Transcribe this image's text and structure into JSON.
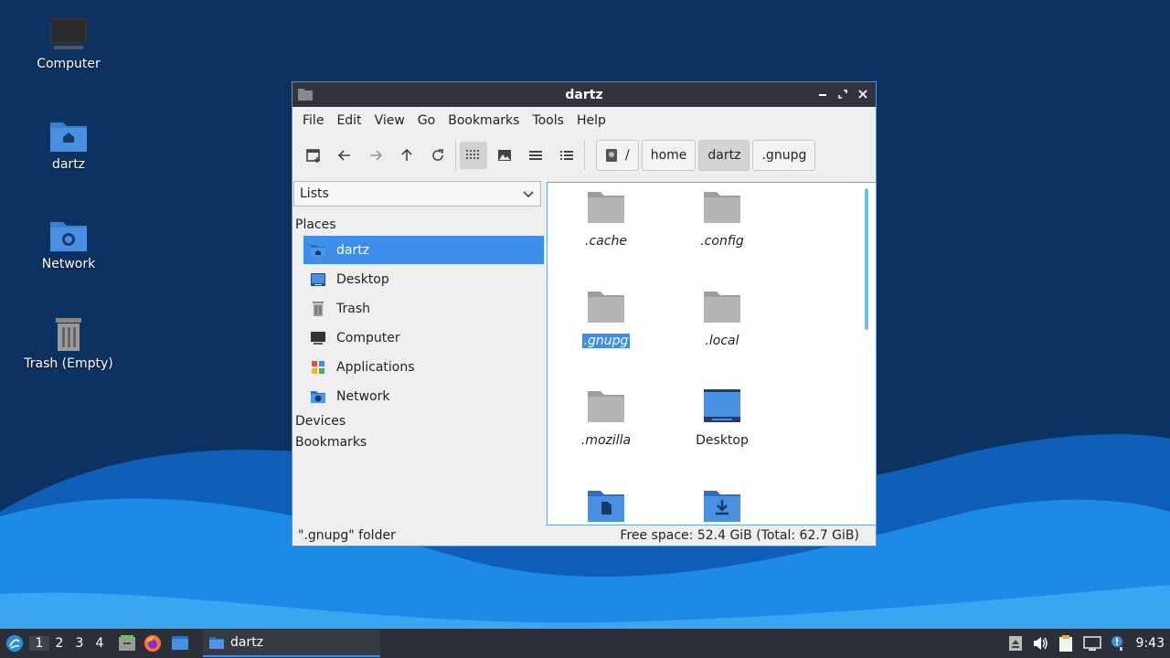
{
  "desktop": {
    "icons": [
      {
        "label": "Computer",
        "icon": "computer-icon"
      },
      {
        "label": "dartz",
        "icon": "home-folder-icon"
      },
      {
        "label": "Network",
        "icon": "network-folder-icon"
      },
      {
        "label": "Trash (Empty)",
        "icon": "trash-icon"
      }
    ]
  },
  "window": {
    "title": "dartz",
    "controls": {
      "minimize": "minimize-icon",
      "maximize": "maximize-icon",
      "close": "close-icon"
    },
    "menu": [
      "File",
      "Edit",
      "View",
      "Go",
      "Bookmarks",
      "Tools",
      "Help"
    ],
    "toolbar": {
      "buttons": [
        "new-tab-icon",
        "back-icon",
        "forward-icon",
        "up-icon",
        "reload-icon",
        "icon-view-icon",
        "thumbnail-view-icon",
        "compact-view-icon",
        "detailed-list-icon"
      ],
      "active_view": "icon-view-icon"
    },
    "breadcrumbs": [
      {
        "label": "/",
        "icon": "root-drive-icon"
      },
      {
        "label": "home"
      },
      {
        "label": "dartz",
        "current": true
      },
      {
        "label": ".gnupg"
      }
    ],
    "side_pane": {
      "mode": "Lists",
      "places_heading": "Places",
      "places": [
        {
          "label": "dartz",
          "icon": "home-folder-icon",
          "selected": true
        },
        {
          "label": "Desktop",
          "icon": "desktop-icon"
        },
        {
          "label": "Trash",
          "icon": "trash-icon"
        },
        {
          "label": "Computer",
          "icon": "computer-icon"
        },
        {
          "label": "Applications",
          "icon": "applications-icon"
        },
        {
          "label": "Network",
          "icon": "network-icon"
        }
      ],
      "devices_heading": "Devices",
      "bookmarks_heading": "Bookmarks"
    },
    "files": [
      {
        "name": ".cache",
        "icon": "folder-icon"
      },
      {
        "name": ".config",
        "icon": "folder-icon"
      },
      {
        "name": ".gnupg",
        "icon": "folder-icon",
        "selected": true
      },
      {
        "name": ".local",
        "icon": "folder-icon"
      },
      {
        "name": ".mozilla",
        "icon": "folder-icon"
      },
      {
        "name": "Desktop",
        "icon": "desktop-folder-icon"
      },
      {
        "name": "",
        "icon": "documents-folder-icon"
      },
      {
        "name": "",
        "icon": "downloads-folder-icon"
      }
    ],
    "status": {
      "left": "\".gnupg\" folder",
      "right": "Free space: 52.4 GiB (Total: 62.7 GiB)"
    }
  },
  "taskbar": {
    "workspaces": [
      "1",
      "2",
      "3",
      "4"
    ],
    "current_workspace": "1",
    "task": "dartz",
    "clock": "9:43",
    "colors": {
      "accent": "#3d8ee8",
      "panel": "#2b3038",
      "titlebar": "#2f343f"
    }
  }
}
